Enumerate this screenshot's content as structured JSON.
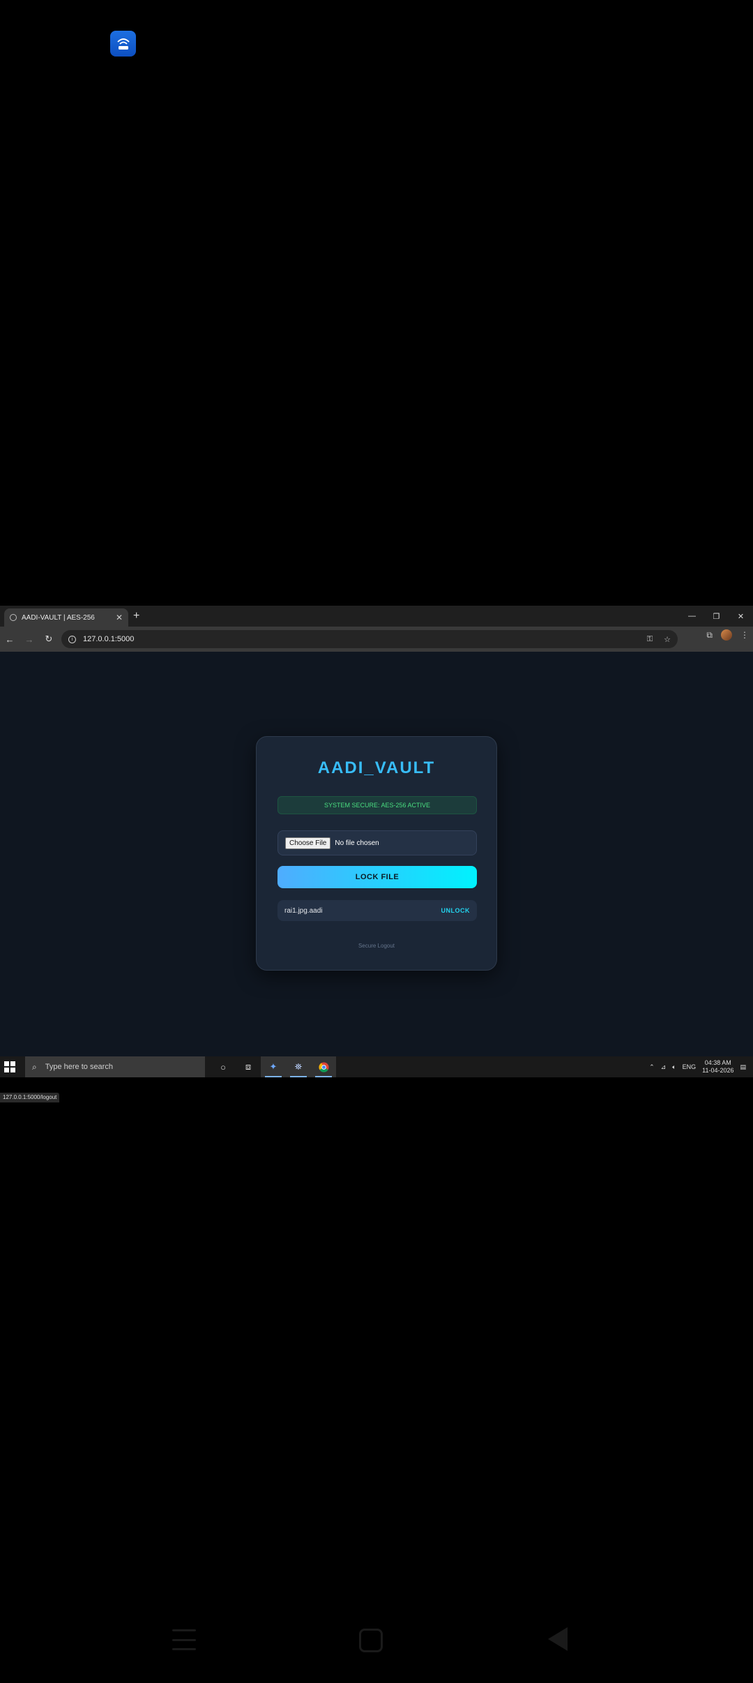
{
  "browser": {
    "tab_title": "AADI-VAULT | AES-256",
    "new_tab_glyph": "+",
    "url": "127.0.0.1:5000",
    "status_url": "127.0.0.1:5000/logout"
  },
  "vault": {
    "title": "AADI_VAULT",
    "status": "SYSTEM SECURE: AES-256 ACTIVE",
    "choose_file_label": "Choose File",
    "no_file_text": "No file chosen",
    "lock_button": "LOCK FILE",
    "files": [
      {
        "name": "rai1.jpg.aadi",
        "action": "UNLOCK"
      }
    ],
    "logout_link": "Secure Logout"
  },
  "taskbar": {
    "search_placeholder": "Type here to search",
    "language": "ENG",
    "time": "04:38 AM",
    "date": "11-04-2026"
  },
  "colors": {
    "accent": "#38bdf8",
    "status_green": "#4ade80",
    "lock_gradient_start": "#4facfe",
    "lock_gradient_end": "#00f2fe",
    "page_bg": "#0f1620",
    "card_bg": "#1b2636"
  }
}
